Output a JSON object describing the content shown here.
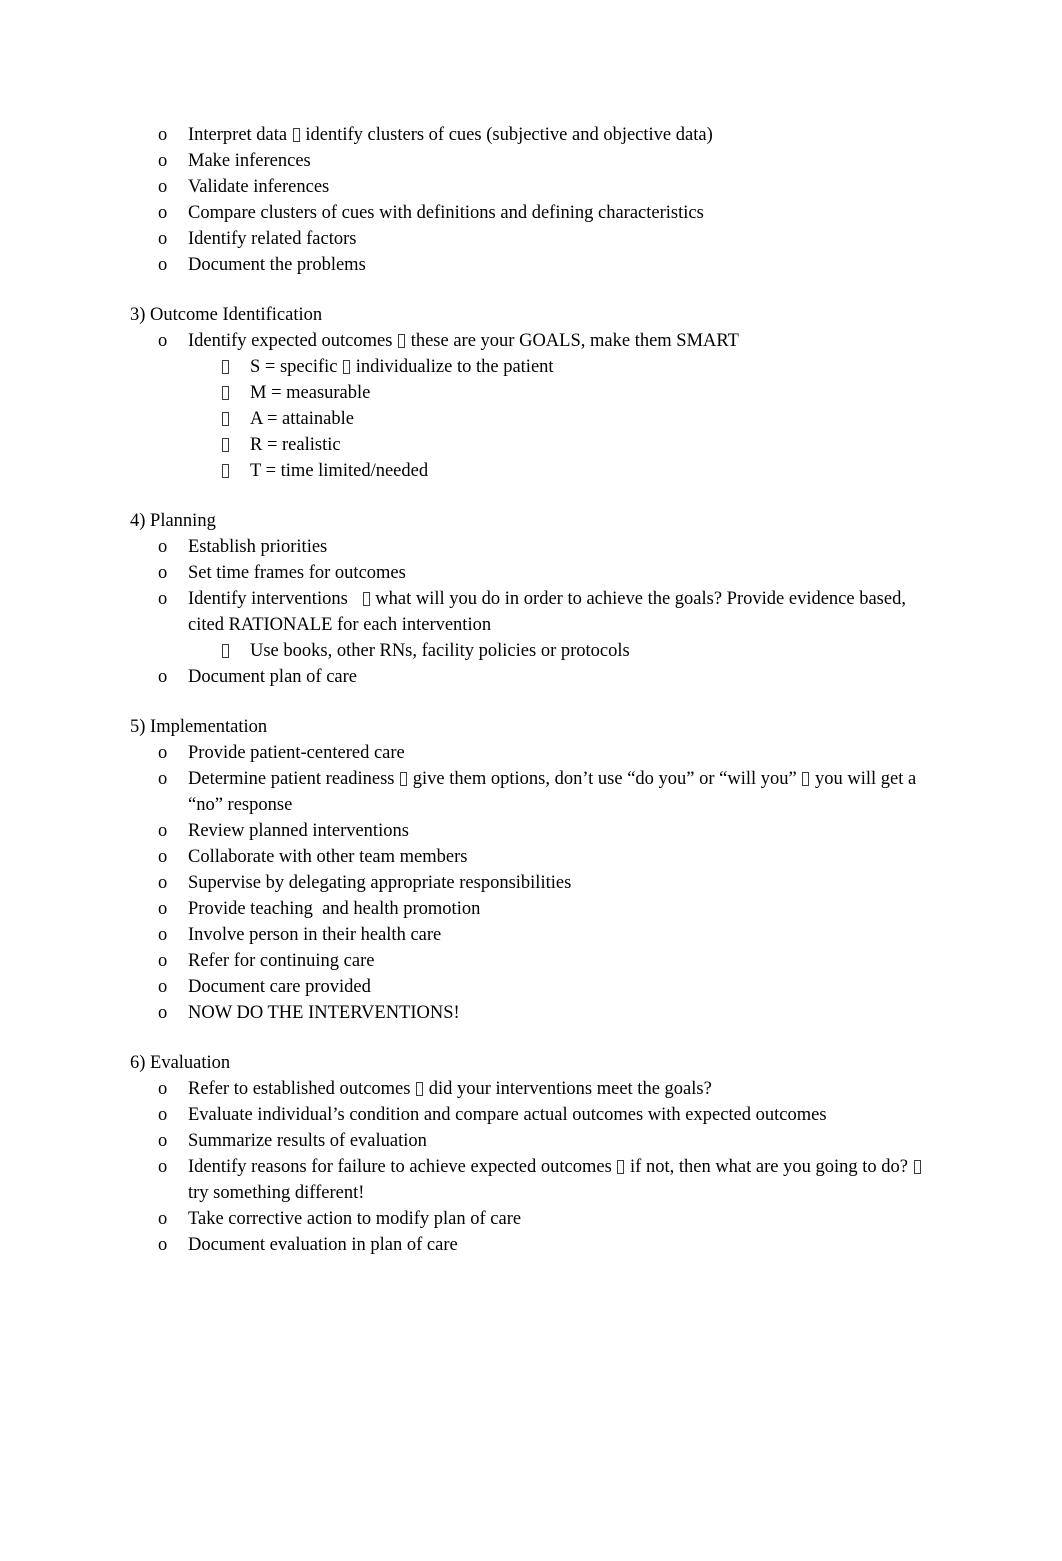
{
  "document": {
    "title": "Nursing Process Steps Outline",
    "page_background": "#ffffff",
    "text_color": "#000000",
    "marker_level2": "o",
    "marker_level3": "box-missing-glyph",
    "inline_arrow_glyph": "box-missing-glyph"
  },
  "sections": [
    {
      "id": "diagnosis-continued",
      "heading": "",
      "items": [
        {
          "level": 2,
          "text_before": "Interpret data ",
          "has_arrow": true,
          "text_after": " identify clusters of cues (subjective and objective data)"
        },
        {
          "level": 2,
          "text_before": "Make inferences",
          "has_arrow": false,
          "text_after": ""
        },
        {
          "level": 2,
          "text_before": "Validate inferences",
          "has_arrow": false,
          "text_after": ""
        },
        {
          "level": 2,
          "text_before": "Compare clusters of cues with definitions and defining characteristics",
          "has_arrow": false,
          "text_after": ""
        },
        {
          "level": 2,
          "text_before": "Identify related factors",
          "has_arrow": false,
          "text_after": ""
        },
        {
          "level": 2,
          "text_before": "Document the problems",
          "has_arrow": false,
          "text_after": ""
        }
      ]
    },
    {
      "id": "outcome-identification",
      "heading": "3) Outcome Identification",
      "items": [
        {
          "level": 2,
          "text_before": "Identify expected outcomes ",
          "has_arrow": true,
          "text_after": " these are your GOALS, make them SMART"
        },
        {
          "level": 3,
          "text_before": "S = specific ",
          "has_arrow": true,
          "text_after": " individualize to the patient"
        },
        {
          "level": 3,
          "text_before": "M = measurable",
          "has_arrow": false,
          "text_after": ""
        },
        {
          "level": 3,
          "text_before": "A = attainable",
          "has_arrow": false,
          "text_after": ""
        },
        {
          "level": 3,
          "text_before": "R = realistic",
          "has_arrow": false,
          "text_after": ""
        },
        {
          "level": 3,
          "text_before": "T = time limited/needed",
          "has_arrow": false,
          "text_after": ""
        }
      ]
    },
    {
      "id": "planning",
      "heading": "4) Planning",
      "items": [
        {
          "level": 2,
          "text_before": "Establish priorities",
          "has_arrow": false,
          "text_after": ""
        },
        {
          "level": 2,
          "text_before": "Set time frames for outcomes",
          "has_arrow": false,
          "text_after": ""
        },
        {
          "level": 2,
          "text_before": "Identify interventions   ",
          "has_arrow": true,
          "text_after": " what will you do in order to achieve the goals? Provide evidence based, cited RATIONALE for each intervention"
        },
        {
          "level": 3,
          "text_before": "Use books, other RNs, facility policies or protocols",
          "has_arrow": false,
          "text_after": ""
        },
        {
          "level": 2,
          "text_before": "Document plan of care",
          "has_arrow": false,
          "text_after": ""
        }
      ]
    },
    {
      "id": "implementation",
      "heading": "5) Implementation",
      "items": [
        {
          "level": 2,
          "text_before": "Provide patient-centered care",
          "has_arrow": false,
          "text_after": ""
        },
        {
          "level": 2,
          "text_before": "Determine patient readiness ",
          "has_arrow": true,
          "text_after": " give them options, don’t use “do you” or “will you” ",
          "has_arrow2": true,
          "text_after2": " you will get a “no” response"
        },
        {
          "level": 2,
          "text_before": "Review planned interventions",
          "has_arrow": false,
          "text_after": ""
        },
        {
          "level": 2,
          "text_before": "Collaborate with other team members",
          "has_arrow": false,
          "text_after": ""
        },
        {
          "level": 2,
          "text_before": "Supervise by delegating appropriate responsibilities",
          "has_arrow": false,
          "text_after": ""
        },
        {
          "level": 2,
          "text_before": "Provide teaching  and health promotion",
          "has_arrow": false,
          "text_after": ""
        },
        {
          "level": 2,
          "text_before": "Involve person in their health care",
          "has_arrow": false,
          "text_after": ""
        },
        {
          "level": 2,
          "text_before": "Refer for continuing care",
          "has_arrow": false,
          "text_after": ""
        },
        {
          "level": 2,
          "text_before": "Document care provided",
          "has_arrow": false,
          "text_after": ""
        },
        {
          "level": 2,
          "text_before": "NOW DO THE INTERVENTIONS!",
          "has_arrow": false,
          "text_after": ""
        }
      ]
    },
    {
      "id": "evaluation",
      "heading": "6) Evaluation",
      "items": [
        {
          "level": 2,
          "text_before": "Refer to established outcomes ",
          "has_arrow": true,
          "text_after": " did your interventions meet the goals?"
        },
        {
          "level": 2,
          "text_before": "Evaluate individual’s condition and compare actual outcomes with expected outcomes",
          "has_arrow": false,
          "text_after": ""
        },
        {
          "level": 2,
          "text_before": "Summarize results of evaluation",
          "has_arrow": false,
          "text_after": ""
        },
        {
          "level": 2,
          "text_before": "Identify reasons for failure to achieve expected outcomes ",
          "has_arrow": true,
          "text_after": " if not, then what are you going to do? ",
          "has_arrow2": true,
          "text_after2": " try something different!"
        },
        {
          "level": 2,
          "text_before": "Take corrective action to modify plan of care",
          "has_arrow": false,
          "text_after": ""
        },
        {
          "level": 2,
          "text_before": "Document evaluation in plan of care",
          "has_arrow": false,
          "text_after": ""
        }
      ]
    }
  ]
}
